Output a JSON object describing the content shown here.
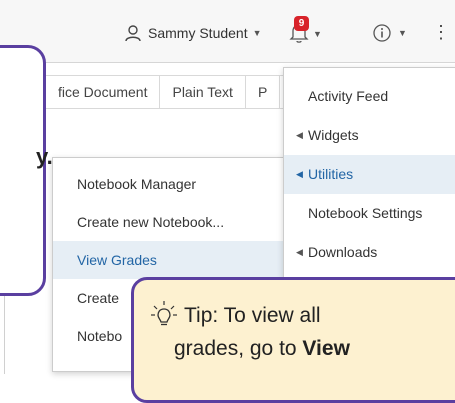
{
  "header": {
    "user_name": "Sammy Student",
    "notification_count": "9"
  },
  "tabs": [
    "fice Document",
    "Plain Text",
    "P"
  ],
  "submenu": {
    "items": [
      "Notebook Manager",
      "Create new Notebook...",
      "View Grades",
      "Create",
      "Notebo"
    ]
  },
  "dropdown": {
    "items": [
      {
        "label": "Activity Feed",
        "has_arrow": false
      },
      {
        "label": "Widgets",
        "has_arrow": true
      },
      {
        "label": "Utilities",
        "has_arrow": true
      },
      {
        "label": "Notebook Settings",
        "has_arrow": false
      },
      {
        "label": "Downloads",
        "has_arrow": true
      }
    ]
  },
  "callout": {
    "text": "y."
  },
  "tip": {
    "line1": "Tip: To view all",
    "line2_prefix": "grades, go to ",
    "line2_bold": "View"
  },
  "colors": {
    "accent": "#5a3fa0",
    "highlight": "#2265a5",
    "badge": "#d8232a",
    "tip_bg": "#fdf1d0"
  }
}
